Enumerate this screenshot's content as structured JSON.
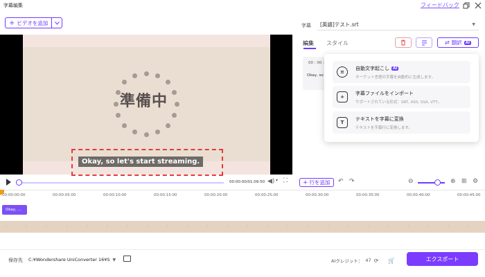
{
  "window": {
    "title": "字幕編集",
    "feedback": "フィードバック",
    "icons": [
      "restore-icon",
      "close-icon"
    ]
  },
  "toolbar": {
    "add_video": "ビデオを追加"
  },
  "preview": {
    "center_text": "準備中",
    "subtitle": "Okay, so let's start streaming.",
    "timecode": "00:00:00/01:09:50"
  },
  "right_panel": {
    "subtitle_label": "字幕",
    "file_name": "[英語]テスト.srt",
    "tabs": [
      "編集",
      "スタイル"
    ],
    "translate_label": "翻訳",
    "ai_badge": "AI",
    "entry": {
      "time": "00 : 00 :",
      "text": "Okay, so"
    }
  },
  "menu": {
    "items": [
      {
        "title": "自動文字起こし",
        "badge": "AI",
        "desc": "ターゲット言語の字幕を自動的に生成します。",
        "icon": "speech-bubble-icon"
      },
      {
        "title": "字幕ファイルをインポート",
        "badge": "",
        "desc": "サポートされている形式：SRT, ASS, SSA, VTT。",
        "icon": "import-file-icon"
      },
      {
        "title": "テキストを字幕に変換",
        "badge": "",
        "desc": "テキストを字幕行に変換します。",
        "icon": "text-convert-icon"
      }
    ]
  },
  "timeline": {
    "add_line": "行を追加",
    "ticks": [
      "00:00:00:00",
      "00:00:05:00",
      "00:00:10:00",
      "00:00:15:00",
      "00:00:20:00",
      "00:00:25:00",
      "00:00:30:00",
      "00:00:35:00",
      "00:00:40:00",
      "00:00:45:00"
    ],
    "clip_text": "Okay, ..."
  },
  "bottom": {
    "save_label": "保存先",
    "path": "C:¥Wondershare UniConverter 16¥S",
    "credit_label": "AIクレジット：",
    "credit_value": "47",
    "export_label": "エクスポート"
  }
}
